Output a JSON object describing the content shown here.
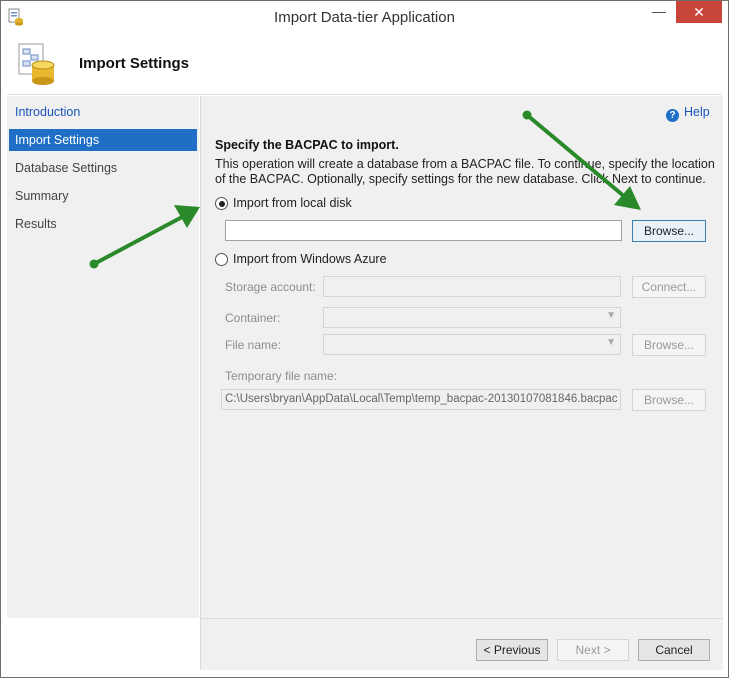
{
  "window": {
    "title": "Import Data-tier Application",
    "minimize_glyph": "—",
    "close_glyph": "✕"
  },
  "header": {
    "title": "Import Settings",
    "icon": "database-import-icon"
  },
  "sidebar": {
    "items": [
      {
        "label": "Introduction",
        "state": "link"
      },
      {
        "label": "Import Settings",
        "state": "active"
      },
      {
        "label": "Database Settings",
        "state": "normal"
      },
      {
        "label": "Summary",
        "state": "normal"
      },
      {
        "label": "Results",
        "state": "normal"
      }
    ]
  },
  "main": {
    "help_label": "Help",
    "heading": "Specify the BACPAC to import.",
    "description": "This operation will create a database from a BACPAC file. To continue, specify the location of the BACPAC.  Optionally, specify settings for the new database. Click Next to continue.",
    "local": {
      "label": "Import from local disk",
      "selected": true,
      "path_value": "",
      "browse_label": "Browse..."
    },
    "azure": {
      "label": "Import from Windows Azure",
      "selected": false,
      "storage_label": "Storage account:",
      "connect_label": "Connect...",
      "container_label": "Container:",
      "filename_label": "File name:",
      "browse_label": "Browse...",
      "temp_label": "Temporary file name:",
      "temp_value": "C:\\Users\\bryan\\AppData\\Local\\Temp\\temp_bacpac-20130107081846.bacpac",
      "temp_browse_label": "Browse..."
    }
  },
  "footer": {
    "previous_label": "< Previous",
    "next_label": "Next >",
    "cancel_label": "Cancel"
  },
  "colors": {
    "accent": "#1f6fc6",
    "annotation_arrow": "#2a8a2a",
    "close": "#c7453b"
  }
}
